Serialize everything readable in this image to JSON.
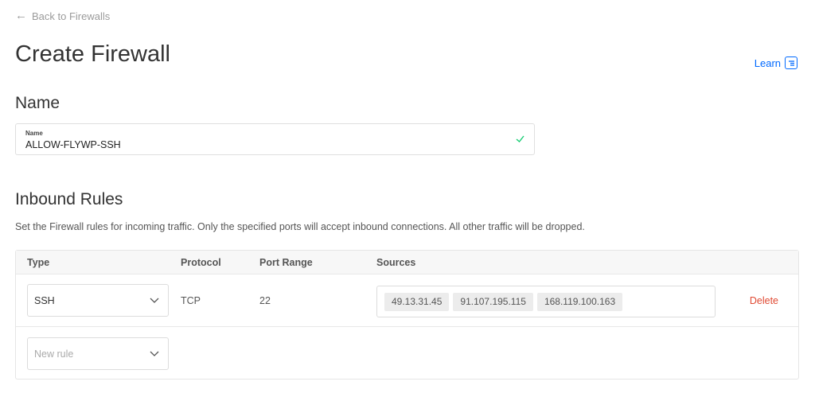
{
  "back": {
    "label": "Back to Firewalls",
    "icon": "arrow-left-icon"
  },
  "page": {
    "title": "Create Firewall"
  },
  "learn": {
    "label": "Learn",
    "icon": "book-icon"
  },
  "name_section": {
    "heading": "Name",
    "field_label": "Name",
    "value": "ALLOW-FLYWP-SSH",
    "valid_icon": "checkmark-icon"
  },
  "inbound": {
    "heading": "Inbound Rules",
    "description": "Set the Firewall rules for incoming traffic. Only the specified ports will accept inbound connections. All other traffic will be dropped.",
    "columns": [
      "Type",
      "Protocol",
      "Port Range",
      "Sources"
    ],
    "rules": [
      {
        "type": "SSH",
        "protocol": "TCP",
        "port_range": "22",
        "sources": [
          "49.13.31.45",
          "91.107.195.115",
          "168.119.100.163"
        ],
        "delete_label": "Delete"
      }
    ],
    "new_rule_placeholder": "New rule"
  },
  "colors": {
    "accent": "#0069ff",
    "danger": "#e04a33",
    "success": "#15cd72"
  }
}
